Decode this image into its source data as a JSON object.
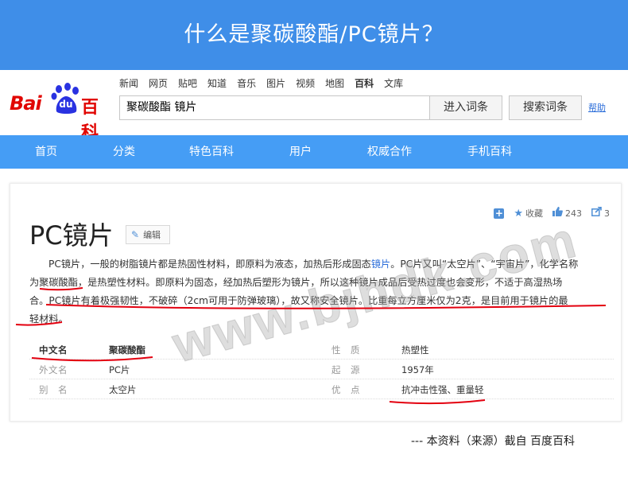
{
  "banner": {
    "title": "什么是聚碳酸酯/PC镜片？"
  },
  "logo": {
    "bai": "Bai",
    "du": "du",
    "baike": "百科"
  },
  "topnav": [
    "新闻",
    "网页",
    "贴吧",
    "知道",
    "音乐",
    "图片",
    "视频",
    "地图",
    "百科",
    "文库"
  ],
  "search": {
    "value": "聚碳酸酯 镜片",
    "enter_label": "进入词条",
    "search_label": "搜索词条",
    "help_label": "帮助"
  },
  "navbar": [
    "首页",
    "分类",
    "特色百科",
    "用户",
    "权威合作",
    "手机百科"
  ],
  "toolbar": {
    "add": "+",
    "fav_label": "收藏",
    "like_count": "243",
    "share_count": "3"
  },
  "entry": {
    "title": "PC镜片",
    "edit_label": "编辑",
    "para": {
      "l1a": "PC镜片，一般的树脂镜片都是热固性材料，即原料为液态，加热后形成固态",
      "l1link": "镜片",
      "l1b": "。PC片又叫“太空片”、“宇宙片”，化学名称",
      "l2": "为聚碳酸酯，是热塑性材料。即原料为固态，经加热后塑形为镜片，所以这种镜片成品后受热过度也会变形，不适于高湿热场",
      "l3": "合。PC镜片有着极强韧性，不破碎（2cm可用于防弹玻璃），故又称安全镜片。比重每立方厘米仅为2克，是目前用于镜片的最",
      "l4": "轻材料。"
    },
    "info": [
      {
        "k1": "中文名",
        "v1": "聚碳酸酯",
        "k2": "性　质",
        "v2": "热塑性"
      },
      {
        "k1": "外文名",
        "v1": "PC片",
        "k2": "起　源",
        "v2": "1957年"
      },
      {
        "k1": "别　名",
        "v1": "太空片",
        "k2": "优　点",
        "v2": "抗冲击性强、重量轻"
      }
    ]
  },
  "footer": {
    "source": "--- 本资料（来源）截自 百度百科"
  },
  "watermark": {
    "text": "www.bjhdk.com"
  },
  "colors": {
    "banner": "#3f8ee8",
    "navbar": "#459df5",
    "logo_red": "#e10602",
    "logo_blue": "#2932e1",
    "annotation": "#e3000f",
    "link": "#2b6dd9"
  }
}
